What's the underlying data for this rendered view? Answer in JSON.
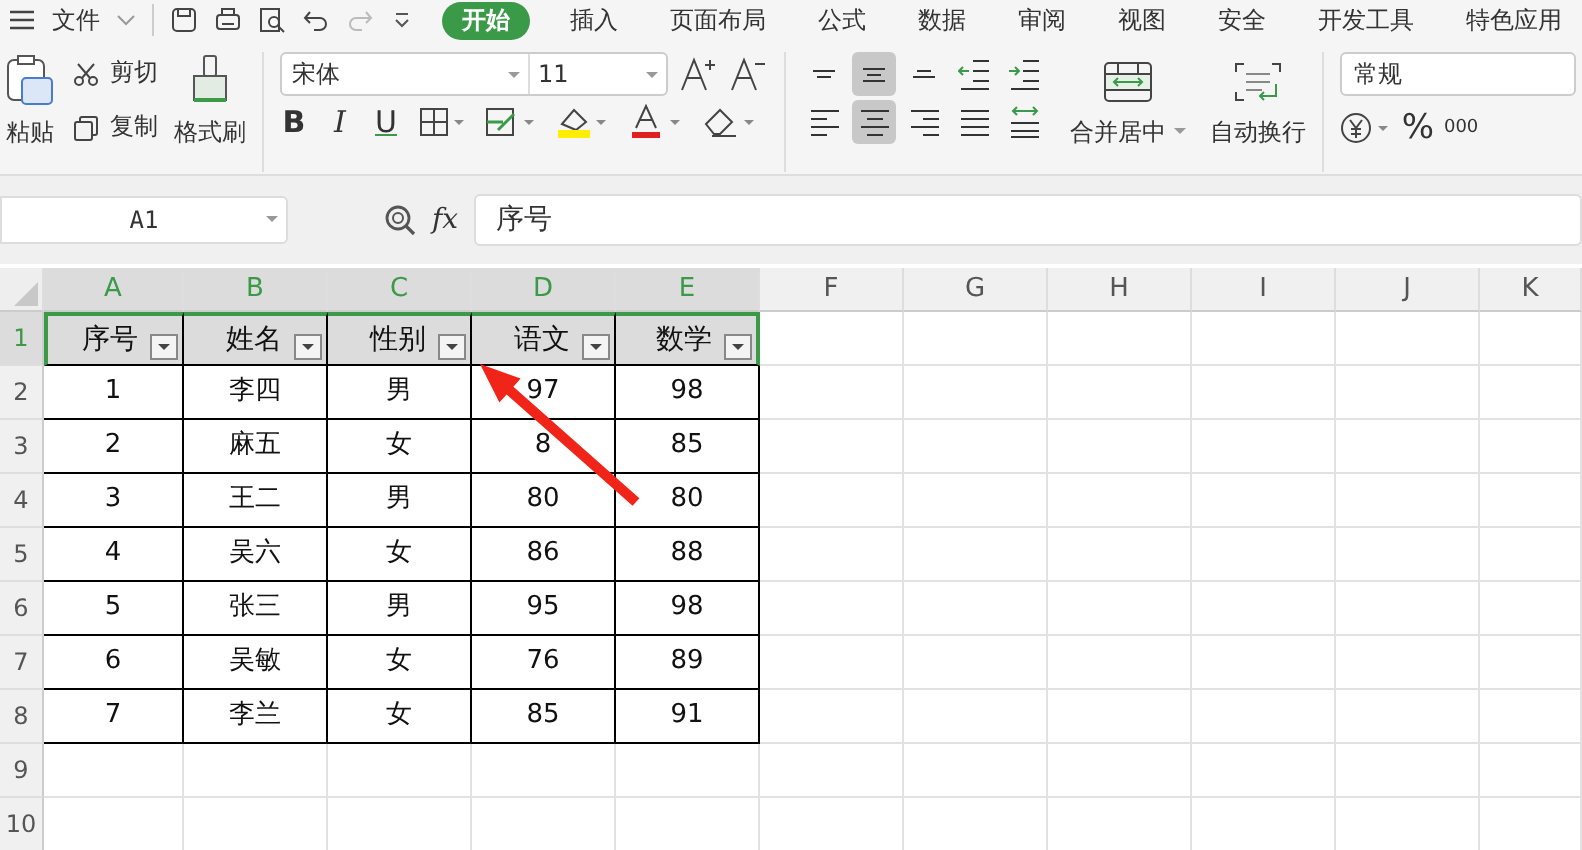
{
  "quick_bar": {
    "file_menu": "文件"
  },
  "ribbon_tabs": [
    {
      "label": "开始",
      "selected": true
    },
    {
      "label": "插入",
      "selected": false
    },
    {
      "label": "页面布局",
      "selected": false
    },
    {
      "label": "公式",
      "selected": false
    },
    {
      "label": "数据",
      "selected": false
    },
    {
      "label": "审阅",
      "selected": false
    },
    {
      "label": "视图",
      "selected": false
    },
    {
      "label": "安全",
      "selected": false
    },
    {
      "label": "开发工具",
      "selected": false
    },
    {
      "label": "特色应用",
      "selected": false
    }
  ],
  "clipboard": {
    "paste": "粘贴",
    "cut": "剪切",
    "copy": "复制",
    "format_painter": "格式刷"
  },
  "font": {
    "name": "宋体",
    "size": "11",
    "style_buttons": [
      "B",
      "I",
      "U"
    ]
  },
  "align_buttons": [
    {
      "kind": "top",
      "selected": false
    },
    {
      "kind": "middle",
      "selected": true
    },
    {
      "kind": "bottom",
      "selected": false
    },
    {
      "kind": "outdent",
      "selected": false
    },
    {
      "kind": "indent",
      "selected": false
    },
    {
      "kind": "left",
      "selected": false
    },
    {
      "kind": "center",
      "selected": true
    },
    {
      "kind": "right",
      "selected": false
    },
    {
      "kind": "justify",
      "selected": false
    },
    {
      "kind": "distribute",
      "selected": false
    }
  ],
  "alignment": {
    "merge": "合并居中",
    "wrap": "自动换行"
  },
  "number": {
    "format": "常规",
    "percent": "%",
    "thousands": "000"
  },
  "formula_bar": {
    "cell_ref": "A1",
    "fx": "fx",
    "value": "序号"
  },
  "columns": [
    {
      "label": "A",
      "selected": true
    },
    {
      "label": "B",
      "selected": true
    },
    {
      "label": "C",
      "selected": true
    },
    {
      "label": "D",
      "selected": true
    },
    {
      "label": "E",
      "selected": true
    },
    {
      "label": "F",
      "selected": false
    },
    {
      "label": "G",
      "selected": false
    },
    {
      "label": "H",
      "selected": false
    },
    {
      "label": "I",
      "selected": false
    },
    {
      "label": "J",
      "selected": false
    },
    {
      "label": "K",
      "selected": false
    }
  ],
  "rows": [
    {
      "number": "1",
      "selected": true,
      "kind": "header",
      "cells": [
        "序号",
        "姓名",
        "性别",
        "语文",
        "数学"
      ]
    },
    {
      "number": "2",
      "selected": false,
      "kind": "data",
      "cells": [
        "1",
        "李四",
        "男",
        "97",
        "98"
      ]
    },
    {
      "number": "3",
      "selected": false,
      "kind": "data",
      "cells": [
        "2",
        "麻五",
        "女",
        "8",
        "85"
      ]
    },
    {
      "number": "4",
      "selected": false,
      "kind": "data",
      "cells": [
        "3",
        "王二",
        "男",
        "80",
        "80"
      ]
    },
    {
      "number": "5",
      "selected": false,
      "kind": "data",
      "cells": [
        "4",
        "吴六",
        "女",
        "86",
        "88"
      ]
    },
    {
      "number": "6",
      "selected": false,
      "kind": "data",
      "cells": [
        "5",
        "张三",
        "男",
        "95",
        "98"
      ]
    },
    {
      "number": "7",
      "selected": false,
      "kind": "data",
      "cells": [
        "6",
        "吴敏",
        "女",
        "76",
        "89"
      ]
    },
    {
      "number": "8",
      "selected": false,
      "kind": "data",
      "cells": [
        "7",
        "李兰",
        "女",
        "85",
        "91"
      ]
    },
    {
      "number": "9",
      "selected": false,
      "kind": "empty",
      "cells": []
    },
    {
      "number": "10",
      "selected": false,
      "kind": "empty",
      "cells": []
    }
  ]
}
